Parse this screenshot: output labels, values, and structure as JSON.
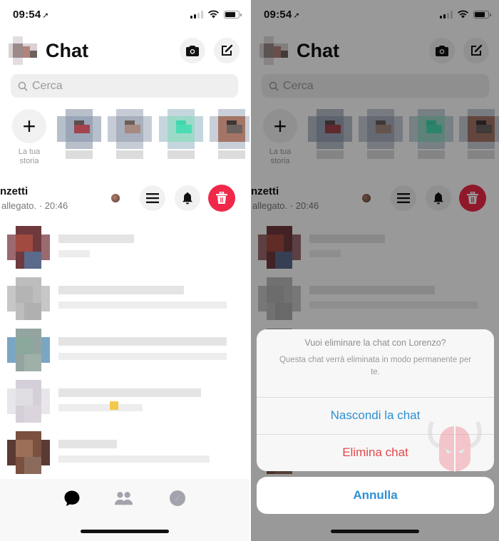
{
  "status_bar": {
    "time": "09:54",
    "location_arrow": "location-arrow-icon"
  },
  "header": {
    "title": "Chat",
    "camera_icon": "camera-icon",
    "compose_icon": "compose-icon"
  },
  "search": {
    "placeholder": "Cerca"
  },
  "stories": {
    "add_label_line1": "La tua",
    "add_label_line2": "storia",
    "items": [
      {
        "colors": [
          "#9aa6b8",
          "#5a4e4e",
          "#a2434e",
          "#b7bfca"
        ]
      },
      {
        "colors": [
          "#a8afbd",
          "#6b5e5a",
          "#a58a80",
          "#c6ccd6"
        ]
      },
      {
        "colors": [
          "#9cdac8",
          "#3fd6ad",
          "#4cdcb4",
          "#c5d6de"
        ]
      },
      {
        "colors": [
          "#a47566",
          "#3d3635",
          "#6c625e",
          "#c9cfd8"
        ]
      }
    ]
  },
  "swiped_chat": {
    "name_partial": "nzetti",
    "preview_partial": "allegato. · 20:46",
    "actions": [
      {
        "name": "more-button",
        "icon": "menu-icon"
      },
      {
        "name": "mute-button",
        "icon": "bell-icon"
      },
      {
        "name": "delete-button",
        "icon": "trash-icon",
        "color": "#f02849"
      }
    ]
  },
  "chats": [
    {
      "avatar_colors": [
        "#a04a40",
        "#6e3a3e",
        "#9a6a70",
        "#5a6a8a"
      ],
      "l1": 106,
      "l2": 44
    },
    {
      "avatar_colors": [
        "#b4b4b4",
        "#bdbdbd",
        "#c7c7c7",
        "#b0b0b0"
      ],
      "l1": 176,
      "l2": 236
    },
    {
      "avatar_colors": [
        "#8aa89c",
        "#94a4a0",
        "#7aa6c4",
        "#9fb0a8"
      ],
      "l1": 236,
      "l2": 236
    },
    {
      "avatar_colors": [
        "#e0dde2",
        "#d4cfd8",
        "#e8e6ea",
        "#dcd4dc"
      ],
      "l1": 200,
      "l2": 118,
      "accent": "#f2c94c"
    },
    {
      "avatar_colors": [
        "#9c7058",
        "#7a5040",
        "#5a3a32",
        "#8a6a5a"
      ],
      "l1": 82,
      "l2": 212
    }
  ],
  "bottom_nav": {
    "items": [
      {
        "name": "chats-tab",
        "icon": "chat-bubble-icon",
        "active": true
      },
      {
        "name": "people-tab",
        "icon": "people-icon",
        "active": false
      },
      {
        "name": "discover-tab",
        "icon": "compass-icon",
        "active": false
      }
    ]
  },
  "dialog": {
    "title": "Vuoi eliminare la chat con Lorenzo?",
    "message": "Questa chat verrà eliminata in modo permanente per te.",
    "hide_label": "Nascondi la chat",
    "delete_label": "Elimina chat",
    "cancel_label": "Annulla",
    "colors": {
      "action": "#2d8fd5",
      "destructive": "#e5474b"
    }
  }
}
